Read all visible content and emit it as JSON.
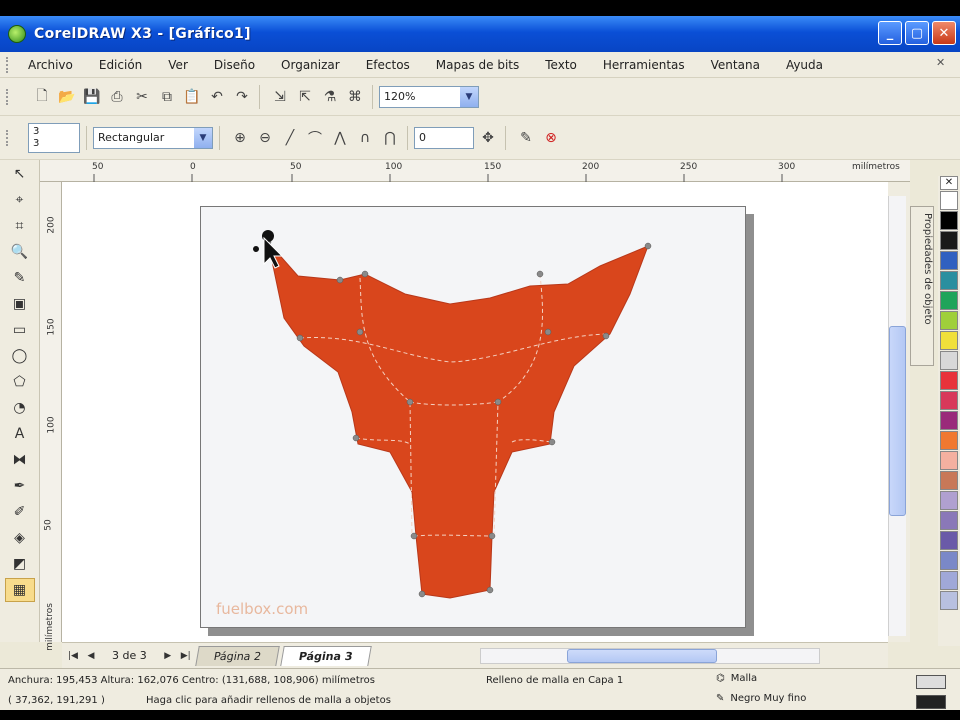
{
  "window": {
    "title": "CorelDRAW X3 - [Gráfico1]"
  },
  "menu": [
    "Archivo",
    "Edición",
    "Ver",
    "Diseño",
    "Organizar",
    "Efectos",
    "Mapas de bits",
    "Texto",
    "Herramientas",
    "Ventana",
    "Ayuda"
  ],
  "toolbar1": {
    "zoom": "120%"
  },
  "toolbar2": {
    "shape_select": "Rectangular",
    "size_a": "3",
    "size_b": "3",
    "value": "0"
  },
  "ruler": {
    "h_ticks": [
      "50",
      "0",
      "50",
      "100",
      "150",
      "200",
      "250",
      "300",
      "milímetros"
    ],
    "v_ticks": [
      "200",
      "150",
      "100",
      "50"
    ],
    "v_unit": "milímetros"
  },
  "canvas": {
    "watermark": "fuelbox.com",
    "fill_color": "#d9461c",
    "page_color": "#f4f5f7"
  },
  "docker": {
    "label": "Propiedades de objeto"
  },
  "page_nav": {
    "count": "3 de 3",
    "tabs": [
      "Página 2",
      "Página 3"
    ],
    "active_tab": "Página 3"
  },
  "status": {
    "row1": "Anchura: 195,453 Altura: 162,076 Centro: (131,688, 108,906) milímetros",
    "row1_mid": "Relleno de malla en Capa 1",
    "row1_right": "Malla",
    "row2": "( 37,362, 191,291 )",
    "row2_mid": "Haga clic para añadir rellenos de malla a objetos",
    "row2_right": "Negro Muy fino"
  },
  "palette": [
    "#ffffff",
    "#000000",
    "#1a1a1a",
    "#3060c0",
    "#2a8f9f",
    "#1fa45a",
    "#9fcf3a",
    "#f0e03a",
    "#d8d8d8",
    "#e8323a",
    "#d8385a",
    "#9a2a7a",
    "#f07830",
    "#f4b0a0",
    "#c87858",
    "#b0a0d0",
    "#8a78b8",
    "#6a5aa8",
    "#7a88c8",
    "#a0a8d8",
    "#b8c0e0"
  ]
}
